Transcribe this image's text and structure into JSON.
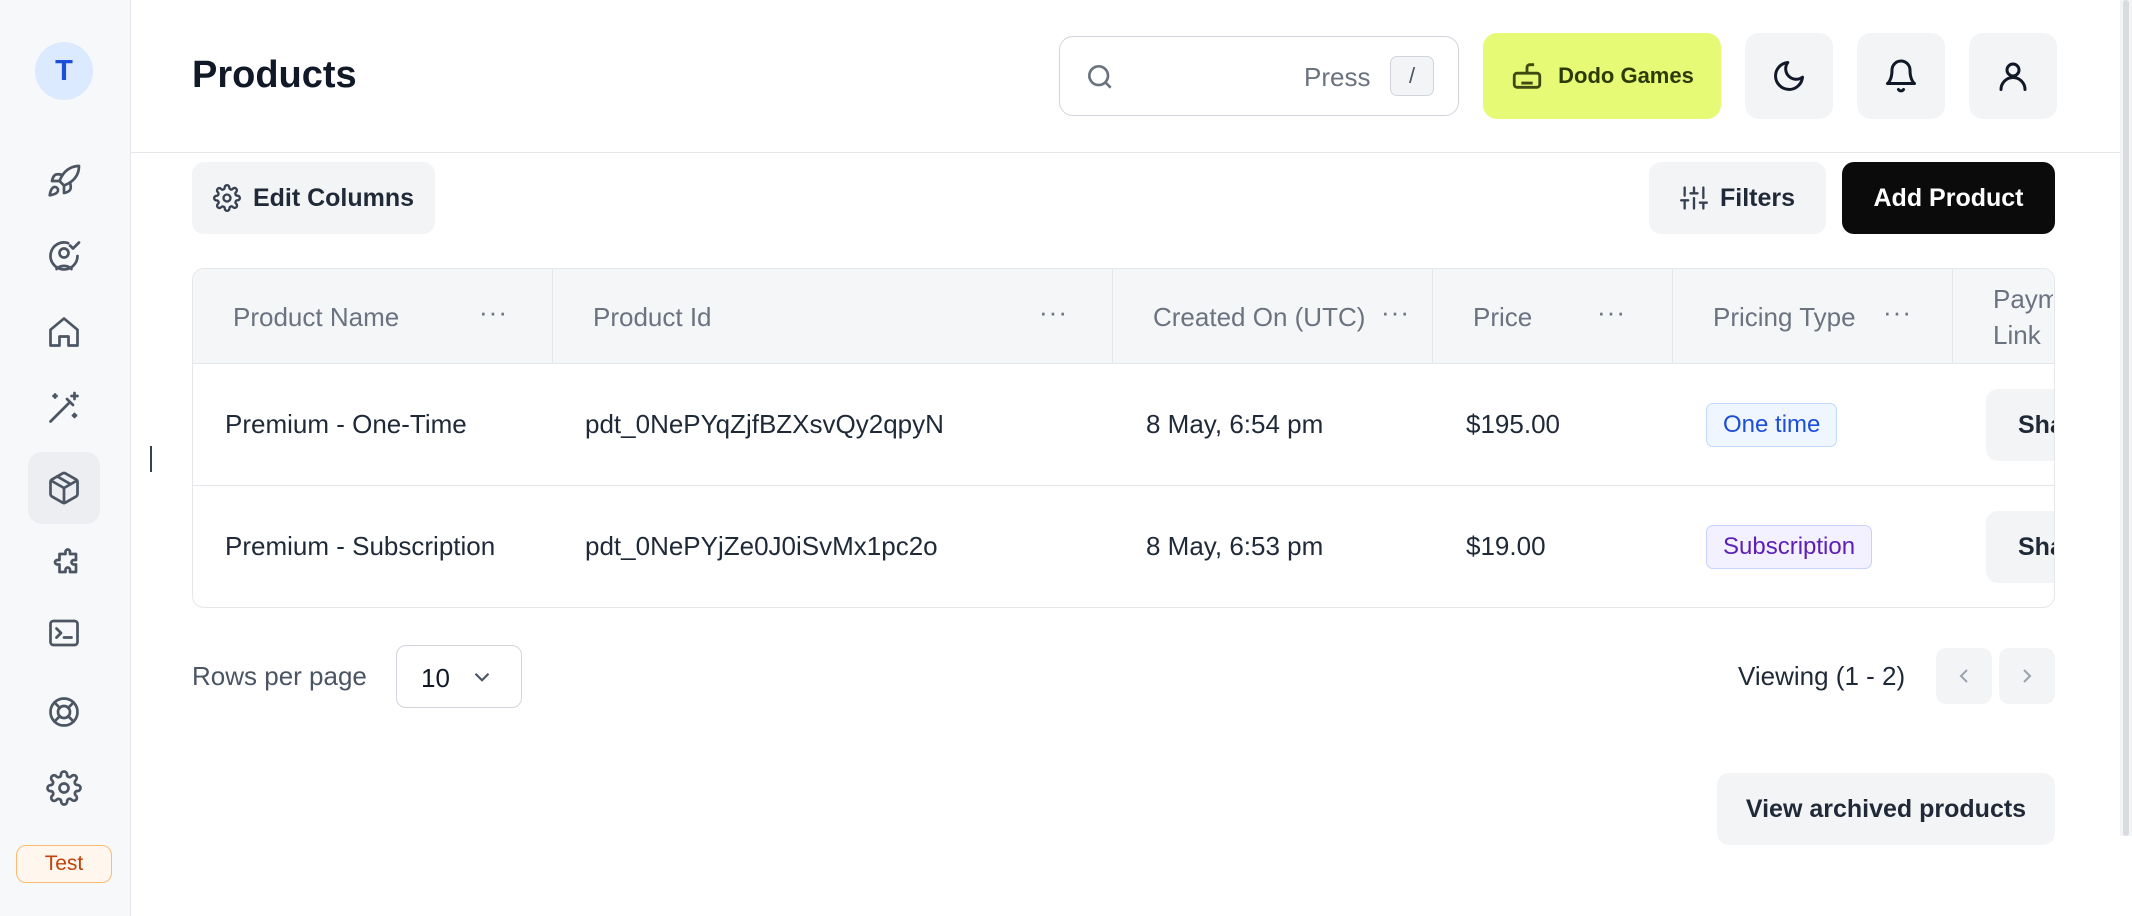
{
  "sidebar": {
    "workspace_initial": "T",
    "items": [
      {
        "name": "rocket-icon"
      },
      {
        "name": "user-check-icon"
      },
      {
        "name": "home-icon"
      },
      {
        "name": "magic-wand-icon"
      },
      {
        "name": "box-icon",
        "active": true
      },
      {
        "name": "puzzle-icon"
      },
      {
        "name": "terminal-icon"
      },
      {
        "name": "lifebuoy-icon"
      },
      {
        "name": "gear-icon"
      }
    ],
    "mode_badge": "Test"
  },
  "header": {
    "title": "Products",
    "search": {
      "press_label": "Press",
      "shortcut": "/"
    },
    "brand_label": "Dodo Games"
  },
  "toolbar": {
    "edit_columns_label": "Edit Columns",
    "filters_label": "Filters",
    "add_product_label": "Add Product"
  },
  "table": {
    "columns": [
      "Product Name",
      "Product Id",
      "Created On (UTC)",
      "Price",
      "Pricing Type",
      "Paym Link"
    ],
    "column_menu": "···",
    "rows": [
      {
        "name": "Premium - One-Time",
        "id": "pdt_0NePYqZjfBZXsvQy2qpyN",
        "created": "8 May, 6:54 pm",
        "price": "$195.00",
        "pricing_type": "One time",
        "action": "Sha"
      },
      {
        "name": "Premium - Subscription",
        "id": "pdt_0NePYjZe0J0iSvMx1pc2o",
        "created": "8 May, 6:53 pm",
        "price": "$19.00",
        "pricing_type": "Subscription",
        "action": "Sha"
      }
    ]
  },
  "pagination": {
    "rows_per_page_label": "Rows per page",
    "rows_per_page_value": "10",
    "viewing_text": "Viewing (1 - 2)"
  },
  "archived_button_label": "View archived products",
  "colors": {
    "brand": "#e6fa76",
    "primary_button": "#0b0b0b",
    "one_time_pill": "#1d4ed8",
    "subscription_pill": "#5b21b6",
    "test_badge": "#c2410c"
  }
}
